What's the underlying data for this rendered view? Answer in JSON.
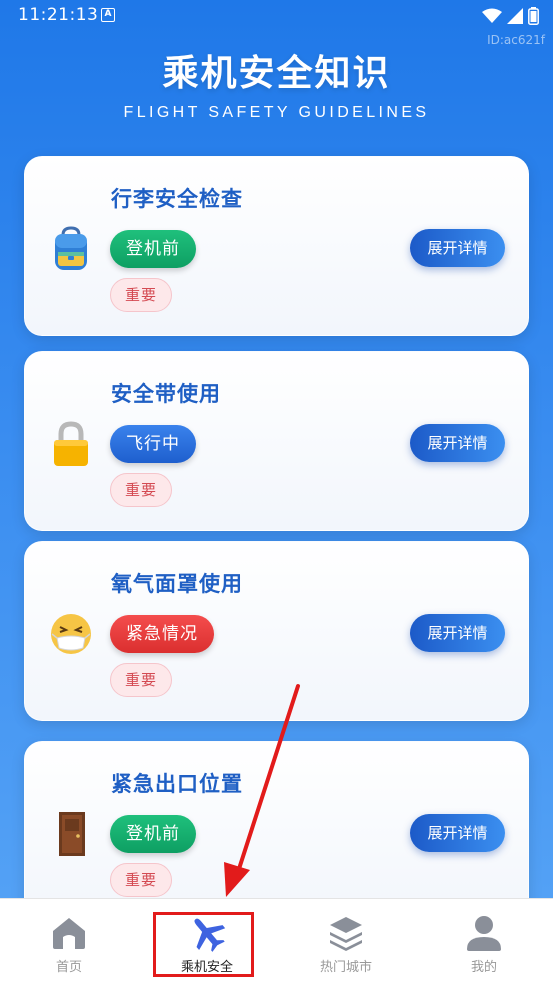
{
  "status_bar": {
    "time": "11:21:13",
    "notification_icon": "A"
  },
  "watermark": "ID:ac621f",
  "header": {
    "title": "乘机安全知识",
    "subtitle": "FLIGHT SAFETY GUIDELINES"
  },
  "cards": [
    {
      "title": "行李安全检查",
      "phase": "登机前",
      "phase_color": "#14b06f",
      "importance": "重要",
      "expand_label": "展开详情",
      "icon": "backpack-icon"
    },
    {
      "title": "安全带使用",
      "phase": "飞行中",
      "phase_color": "#2d72e0",
      "importance": "重要",
      "expand_label": "展开详情",
      "icon": "lock-icon"
    },
    {
      "title": "氧气面罩使用",
      "phase": "紧急情况",
      "phase_color": "#e83a3a",
      "importance": "重要",
      "expand_label": "展开详情",
      "icon": "mask-face-icon"
    },
    {
      "title": "紧急出口位置",
      "phase": "登机前",
      "phase_color": "#14b06f",
      "importance": "重要",
      "expand_label": "展开详情",
      "icon": "door-icon"
    }
  ],
  "tab_bar": {
    "tabs": [
      {
        "label": "首页",
        "icon": "home-icon",
        "active": false
      },
      {
        "label": "乘机安全",
        "icon": "airplane-icon",
        "active": true
      },
      {
        "label": "热门城市",
        "icon": "layers-icon",
        "active": false
      },
      {
        "label": "我的",
        "icon": "user-icon",
        "active": false
      }
    ]
  },
  "colors": {
    "accent": "#2d72e0",
    "title_blue": "#1f5fc4",
    "annotation_red": "#e21b1b"
  }
}
